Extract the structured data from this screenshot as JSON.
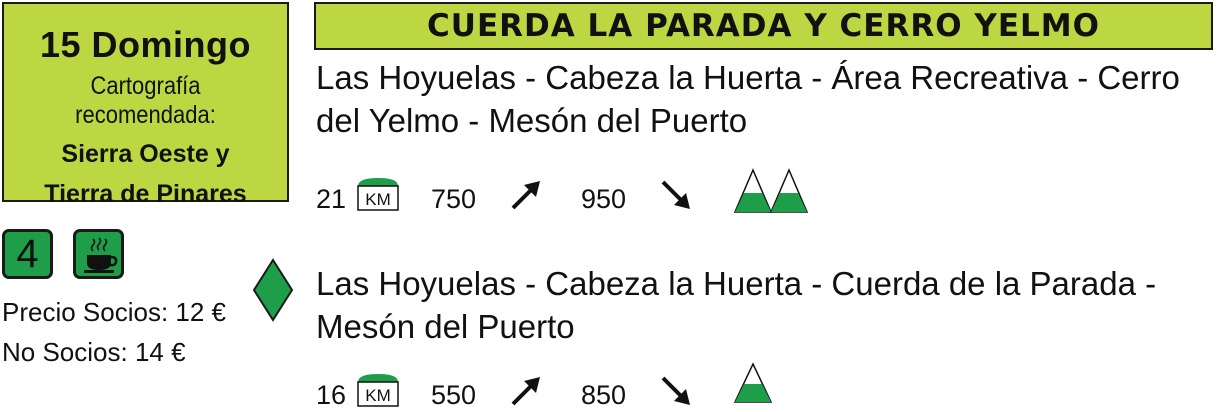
{
  "event": {
    "date": "15 Domingo",
    "cartography_label": "Cartografía recomendada:",
    "regions": [
      "Sierra Oeste y",
      "Tierra de Pinares"
    ]
  },
  "level": "4",
  "icons": {
    "coffee": "coffee-cup-icon",
    "difficulty": "diamond-icon",
    "distance": "km-icon",
    "ascent": "arrow-up-right-icon",
    "descent": "arrow-down-right-icon",
    "mountain": "mountain-peak-icon"
  },
  "prices": {
    "members": "Precio Socios: 12 €",
    "non_members": "No Socios: 14 €"
  },
  "title": "CUERDA LA PARADA Y CERRO YELMO",
  "routes": [
    {
      "description": "Las Hoyuelas - Cabeza la Huerta - Área Recreativa - Cerro del Yelmo - Mesón del Puerto",
      "distance": "21",
      "km_label": "KM",
      "ascent": "750",
      "descent": "950",
      "peaks": 2
    },
    {
      "description": "Las Hoyuelas - Cabeza la Huerta - Cuerda de la Parada - Mesón del Puerto",
      "distance": "16",
      "km_label": "KM",
      "ascent": "550",
      "descent": "850",
      "peaks": 1
    }
  ],
  "colors": {
    "accent": "#bcd742",
    "badge": "#1f9e4a",
    "diamond": "#1f9e4a",
    "mountain_fill": "#1f9e4a"
  }
}
